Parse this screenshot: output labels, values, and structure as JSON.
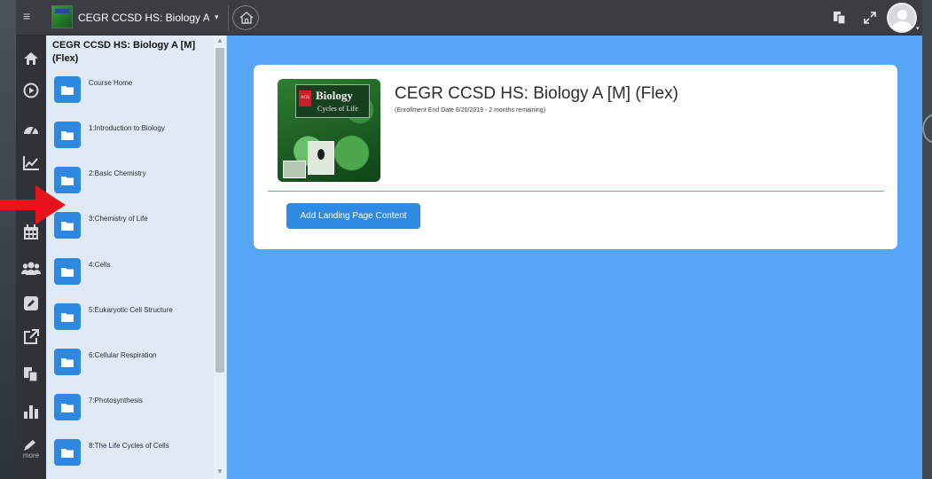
{
  "topbar": {
    "course_title": "CEGR CCSD HS: Biology A ...",
    "caret": "▾",
    "avatar_caret": "▾"
  },
  "leftrail": {
    "icons": [
      "home-icon",
      "play-circle-icon",
      "dashboard-icon",
      "chart-line-icon",
      "calendar-icon",
      "users-icon",
      "edit-icon",
      "external-link-icon",
      "copy-icon",
      "bar-chart-icon",
      "pen-icon"
    ],
    "more_label": "more"
  },
  "sidebar": {
    "title": "CEGR CCSD HS: Biology A [M] (Flex)",
    "items": [
      {
        "label": "Course Home"
      },
      {
        "label": "1:Introduction to Biology"
      },
      {
        "label": "2:Basic Chemistry"
      },
      {
        "label": "3:Chemistry of Life"
      },
      {
        "label": "4:Cells"
      },
      {
        "label": "5:Eukaryotic Cell Structure"
      },
      {
        "label": "6:Cellular Respiration"
      },
      {
        "label": "7:Photosynthesis"
      },
      {
        "label": "8:The Life Cycles of Cells"
      }
    ]
  },
  "main": {
    "cover": {
      "title": "Biology",
      "subtitle": "Cycles of Life",
      "logo": "AGS"
    },
    "course_title": "CEGR CCSD HS: Biology A [M] (Flex)",
    "enrollment_note": "(Enrollment End Date 6/20/2019 - 2 months remaining)",
    "add_button": "Add Landing Page Content"
  },
  "colors": {
    "main_bg": "#56a6f7",
    "topbar_bg": "#3a3e43",
    "sidebar_bg": "#dfeaf6",
    "folder_blue": "#2f88e0",
    "button_blue": "#2f8ae2",
    "arrow_red": "#e8141c"
  }
}
